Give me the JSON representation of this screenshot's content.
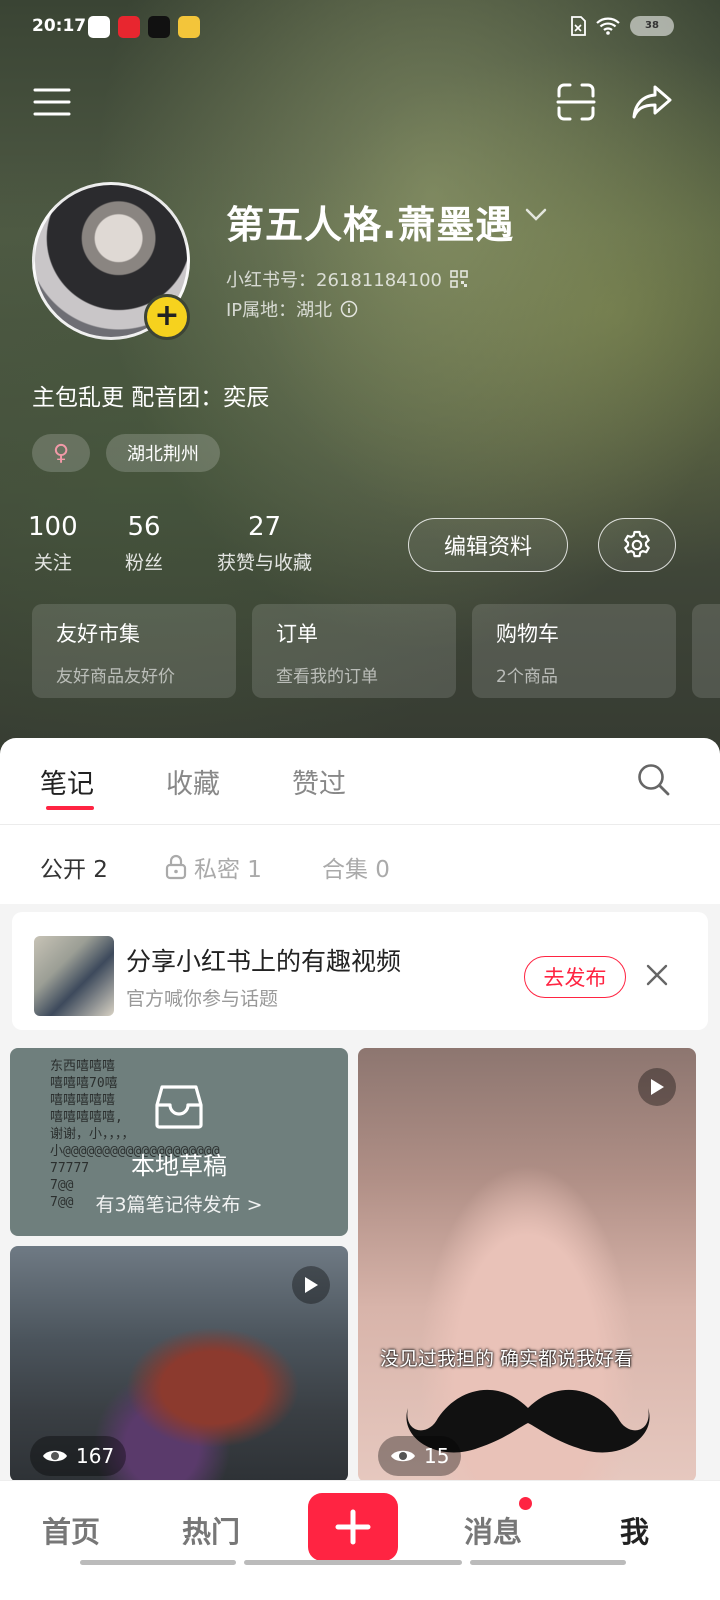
{
  "status_bar": {
    "time": "20:17",
    "battery": "38"
  },
  "profile": {
    "nickname": "第五人格.萧墨遇",
    "red_id": "小红书号：26181184100",
    "ip_location": "IP属地：湖北",
    "bio": "主包乱更 配音团：奕辰",
    "tags": {
      "gender": "♀",
      "location": "湖北荆州"
    },
    "stats": [
      {
        "value": "100",
        "label": "关注"
      },
      {
        "value": "56",
        "label": "粉丝"
      },
      {
        "value": "27",
        "label": "获赞与收藏"
      }
    ],
    "edit_button": "编辑资料"
  },
  "shortcut_cards": [
    {
      "title": "友好市集",
      "subtitle": "友好商品友好价"
    },
    {
      "title": "订单",
      "subtitle": "查看我的订单"
    },
    {
      "title": "购物车",
      "subtitle": "2个商品"
    }
  ],
  "tabs": {
    "notes": "笔记",
    "collections": "收藏",
    "liked": "赞过"
  },
  "subtabs": {
    "public": "公开 2",
    "private": "私密 1",
    "albums": "合集 0"
  },
  "promo": {
    "title": "分享小红书上的有趣视频",
    "subtitle": "官方喊你参与话题",
    "button": "去发布"
  },
  "drafts": {
    "background_text": "东西嘻嘻嘻\n嘻嘻嘻70嘻\n嘻嘻嘻嘻嘻\n嘻嘻嘻嘻嘻,\n谢谢，小，，，，\n小@@@@@@@@@@@@@@@@@@@@\n77777\n7@@\n7@@",
    "title": "本地草稿",
    "subtitle": "有3篇笔记待发布 >"
  },
  "posts": [
    {
      "views": "167"
    },
    {
      "views": "15",
      "caption": "没见过我担的 确实都说我好看"
    }
  ],
  "bottom_nav": {
    "home": "首页",
    "hot": "热门",
    "messages": "消息",
    "me": "我"
  },
  "colors": {
    "accent": "#ff2442",
    "avatar_badge": "#f6d21e"
  }
}
